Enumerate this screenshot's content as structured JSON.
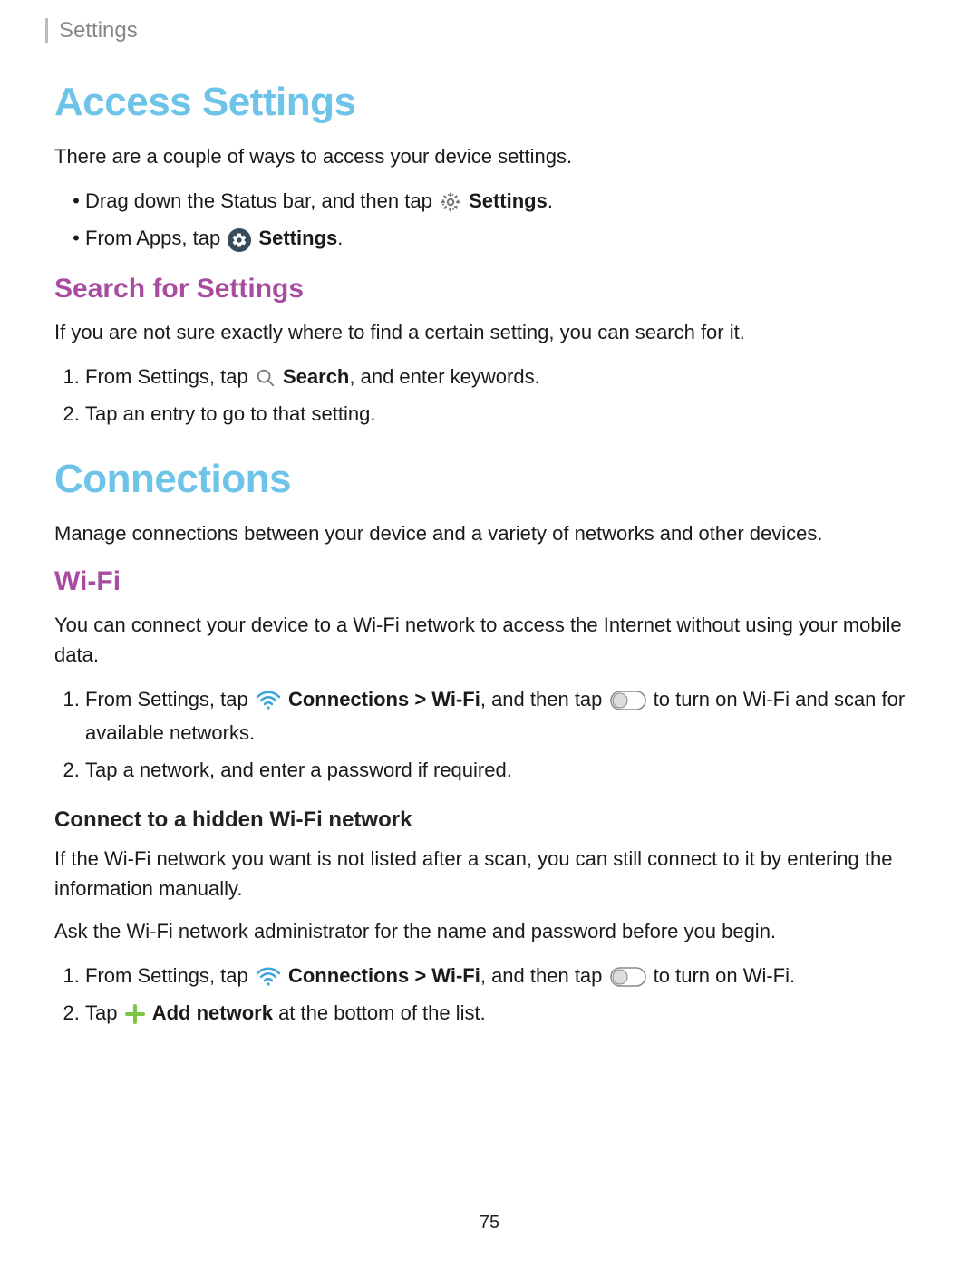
{
  "header": {
    "breadcrumb": "Settings"
  },
  "section1": {
    "title": "Access Settings",
    "intro": "There are a couple of ways to access your device settings.",
    "bullets": {
      "b1_pre": "Drag down the Status bar, and then tap ",
      "b1_bold": "Settings",
      "b1_post": ".",
      "b2_pre": "From Apps, tap ",
      "b2_bold": "Settings",
      "b2_post": "."
    },
    "sub1": {
      "title": "Search for Settings",
      "intro": "If you are not sure exactly where to find a certain setting, you can search for it.",
      "steps": {
        "s1_pre": "From Settings, tap ",
        "s1_bold": "Search",
        "s1_post": ", and enter keywords.",
        "s2": "Tap an entry to go to that setting."
      }
    }
  },
  "section2": {
    "title": "Connections",
    "intro": "Manage connections between your device and a variety of networks and other devices.",
    "sub1": {
      "title": "Wi-Fi",
      "intro": "You can connect your device to a Wi-Fi network to access the Internet without using your mobile data.",
      "steps": {
        "s1_pre": "From Settings, tap ",
        "s1_bold": "Connections > Wi-Fi",
        "s1_mid": ", and then tap ",
        "s1_post": " to turn on Wi-Fi and scan for available networks.",
        "s2": "Tap a network, and enter a password if required."
      },
      "subsub": {
        "title": "Connect to a hidden Wi-Fi network",
        "intro": "If the Wi-Fi network you want is not listed after a scan, you can still connect to it by entering the information manually.",
        "intro2": "Ask the Wi-Fi network administrator for the name and password before you begin.",
        "steps": {
          "s1_pre": "From Settings, tap ",
          "s1_bold": "Connections > Wi-Fi",
          "s1_mid": ", and then tap ",
          "s1_post": " to turn on Wi-Fi.",
          "s2_pre": "Tap ",
          "s2_bold": "Add network",
          "s2_post": " at the bottom of the list."
        }
      }
    }
  },
  "page_number": "75"
}
